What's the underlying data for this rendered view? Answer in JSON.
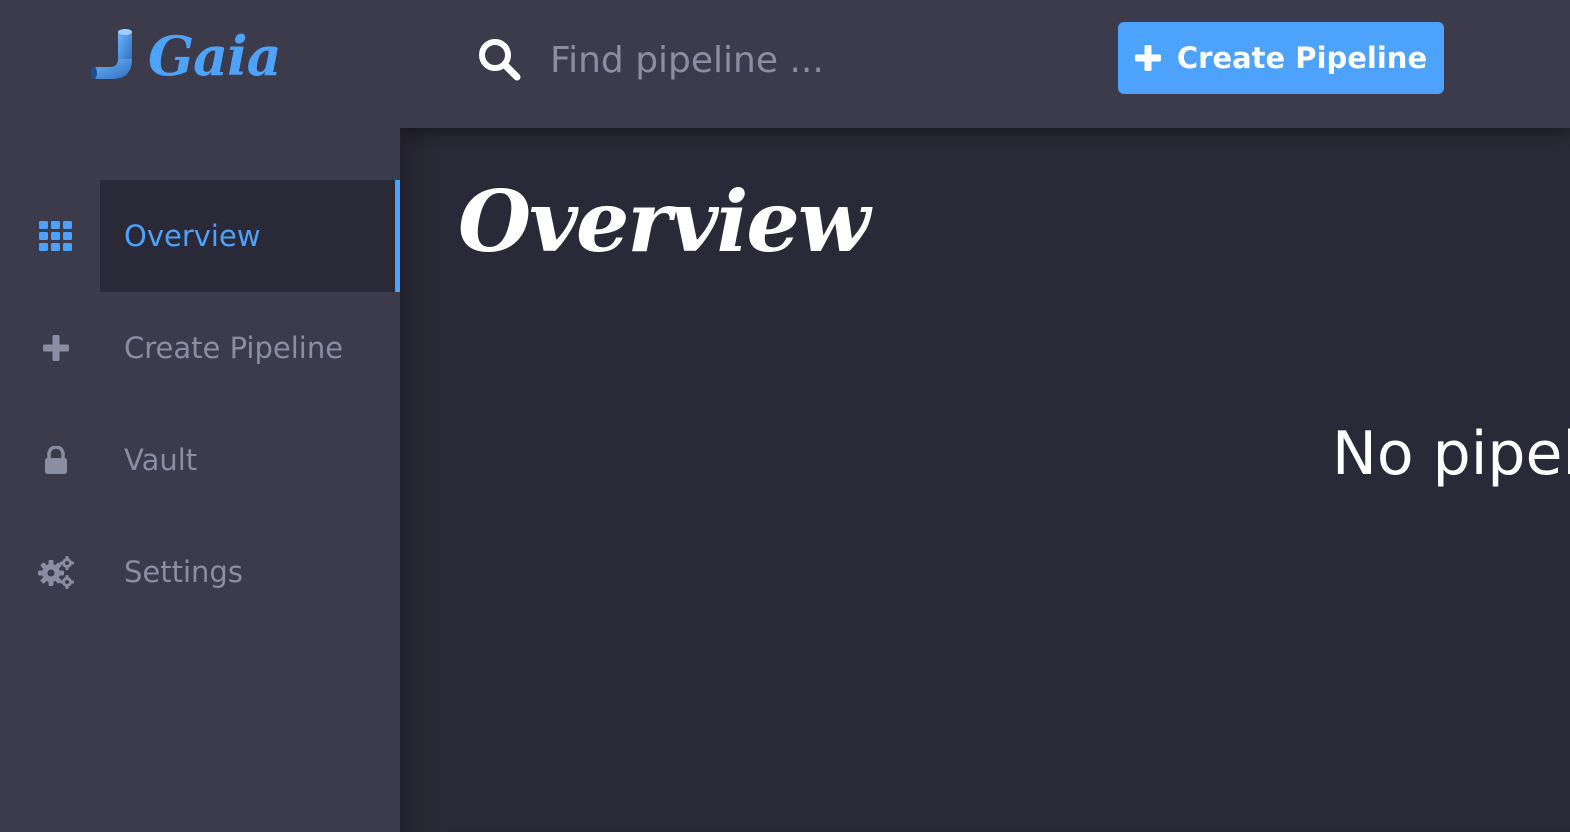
{
  "app": {
    "brand_name": "Gaia"
  },
  "colors": {
    "accent": "#4da2fc",
    "sidebar_bg": "#3c3b4c",
    "main_bg": "#2a2937",
    "muted_text": "#8a8ea3"
  },
  "sidebar": {
    "items": [
      {
        "label": "Overview",
        "icon": "grid-icon",
        "active": true
      },
      {
        "label": "Create Pipeline",
        "icon": "plus-icon",
        "active": false
      },
      {
        "label": "Vault",
        "icon": "lock-icon",
        "active": false
      },
      {
        "label": "Settings",
        "icon": "gears-icon",
        "active": false
      }
    ]
  },
  "header": {
    "search_placeholder": "Find pipeline ...",
    "create_button_label": "Create Pipeline"
  },
  "main": {
    "title": "Overview",
    "empty_message": "No pipel"
  }
}
